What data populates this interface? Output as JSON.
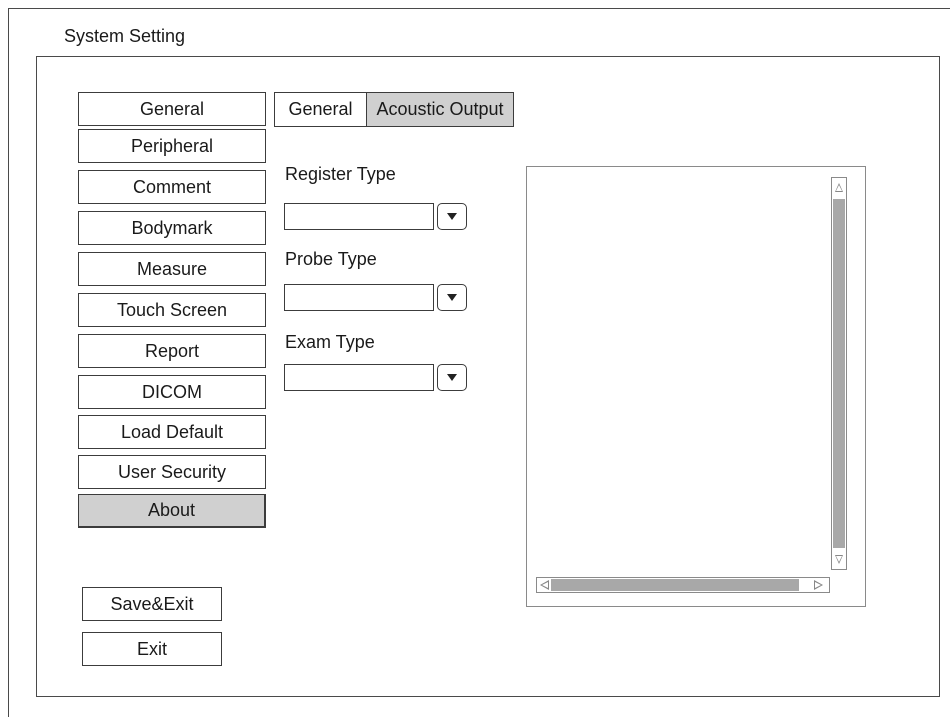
{
  "window": {
    "title": "System Setting"
  },
  "sidebar": {
    "items": [
      {
        "label": "General"
      },
      {
        "label": "Peripheral"
      },
      {
        "label": "Comment"
      },
      {
        "label": "Bodymark"
      },
      {
        "label": "Measure"
      },
      {
        "label": "Touch Screen"
      },
      {
        "label": "Report"
      },
      {
        "label": "DICOM"
      },
      {
        "label": "Load Default"
      },
      {
        "label": "User Security"
      },
      {
        "label": "About"
      }
    ],
    "active": "About"
  },
  "tabs": [
    {
      "label": "General"
    },
    {
      "label": "Acoustic Output"
    }
  ],
  "selected_tab": "Acoustic Output",
  "fields": {
    "register_type": {
      "label": "Register Type",
      "value": ""
    },
    "probe_type": {
      "label": "Probe Type",
      "value": ""
    },
    "exam_type": {
      "label": "Exam Type",
      "value": ""
    }
  },
  "footer": {
    "save_exit": "Save&Exit",
    "exit": "Exit"
  },
  "colors": {
    "active_fill": "#d0d0d0",
    "border": "#3c3c3c",
    "scroll_thumb": "#a8a8a8"
  }
}
